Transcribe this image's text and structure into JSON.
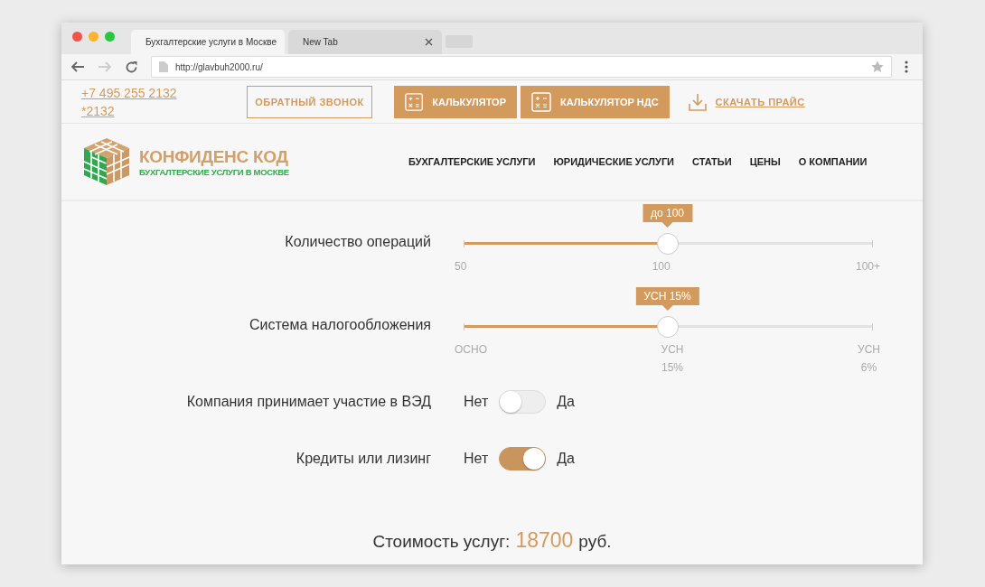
{
  "browser": {
    "tabs": [
      {
        "title": "Бухгалтерские услуги в Москве",
        "selected": true
      },
      {
        "title": "New Tab",
        "selected": false
      }
    ],
    "url": "http://glavbuh2000.ru/"
  },
  "topbar": {
    "phone_lines": [
      "+7 495 255 2132",
      "*2132"
    ],
    "callback_button": "ОБРАТНЫЙ ЗВОНОК",
    "calc_buttons": [
      "КАЛЬКУЛЯТОР",
      "КАЛЬКУЛЯТОР НДС"
    ],
    "download_link": "СКАЧАТЬ ПРАЙС"
  },
  "logo": {
    "title": "КОНФИДЕНС КОД",
    "subtitle": "БУХГАЛТЕРСКИЕ УСЛУГИ В МОСКВЕ"
  },
  "nav": [
    "БУХГАЛТЕРСКИЕ УСЛУГИ",
    "ЮРИДИЧЕСКИЕ УСЛУГИ",
    "СТАТЬИ",
    "ЦЕНЫ",
    "О КОМПАНИИ"
  ],
  "calculator": {
    "sliders": [
      {
        "label": "Количество операций",
        "tooltip": "до 100",
        "level": 0.5,
        "ticks": [
          [
            "50"
          ],
          [
            "100"
          ],
          [
            "100+"
          ]
        ]
      },
      {
        "label": "Система налогообложения",
        "tooltip": "УСН 15%",
        "level": 0.5,
        "ticks": [
          [
            "ОСНО"
          ],
          [
            "УСН",
            "15%"
          ],
          [
            "УСН",
            "6%"
          ]
        ]
      }
    ],
    "toggles": [
      {
        "label": "Компания принимает участие в ВЭД",
        "off_label": "Нет",
        "on_label": "Да",
        "on": false
      },
      {
        "label": "Кредиты или лизинг",
        "off_label": "Нет",
        "on_label": "Да",
        "on": true
      }
    ],
    "total": {
      "label": "Стоимость услуг:",
      "value": "18700",
      "unit": "руб."
    }
  }
}
